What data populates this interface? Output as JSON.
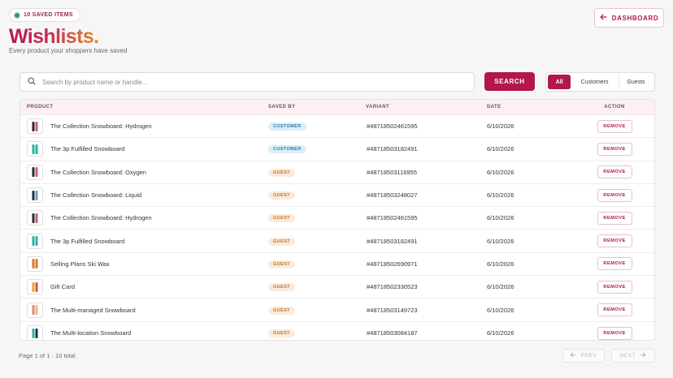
{
  "header": {
    "badge": "10 SAVED ITEMS",
    "title": "Wishlists.",
    "subtitle": "Every product your shoppers have saved",
    "dashboard_label": "DASHBOARD"
  },
  "search": {
    "placeholder": "Search by product name or handle...",
    "button_label": "SEARCH"
  },
  "filters": {
    "selected": "All",
    "options": [
      "All",
      "Customers",
      "Guests"
    ]
  },
  "table": {
    "columns": [
      "PRODUCT",
      "SAVED BY",
      "VARIANT",
      "DATE",
      "ACTION"
    ],
    "rows": [
      {
        "product": "The Collection Snowboard: Hydrogen",
        "saved_by": "CUSTOMER",
        "variant": "#48718502461595",
        "date": "6/10/2026",
        "action": "REMOVE",
        "thumb": [
          "#2b2b33",
          "#c65a8b"
        ]
      },
      {
        "product": "The 3p Fulfilled Snowboard",
        "saved_by": "CUSTOMER",
        "variant": "#48718503182491",
        "date": "6/10/2026",
        "action": "REMOVE",
        "thumb": [
          "#2bb3a3",
          "#2bb3a3"
        ]
      },
      {
        "product": "The Collection Snowboard: Oxygen",
        "saved_by": "GUEST",
        "variant": "#48718503116955",
        "date": "6/10/2026",
        "action": "REMOVE",
        "thumb": [
          "#2b2b33",
          "#d75a8f"
        ]
      },
      {
        "product": "The Collection Snowboard: Liquid",
        "saved_by": "GUEST",
        "variant": "#48718503248027",
        "date": "6/10/2026",
        "action": "REMOVE",
        "thumb": [
          "#2b2b33",
          "#6aa0c9"
        ]
      },
      {
        "product": "The Collection Snowboard: Hydrogen",
        "saved_by": "GUEST",
        "variant": "#48718502461595",
        "date": "6/10/2026",
        "action": "REMOVE",
        "thumb": [
          "#2b2b33",
          "#c65a8b"
        ]
      },
      {
        "product": "The 3p Fulfilled Snowboard",
        "saved_by": "GUEST",
        "variant": "#48718503182491",
        "date": "6/10/2026",
        "action": "REMOVE",
        "thumb": [
          "#2bb3a3",
          "#2bb3a3"
        ]
      },
      {
        "product": "Selling Plans Ski Wax",
        "saved_by": "GUEST",
        "variant": "#48718502690971",
        "date": "6/10/2026",
        "action": "REMOVE",
        "thumb": [
          "#e0782b",
          "#e0782b"
        ]
      },
      {
        "product": "Gift Card",
        "saved_by": "GUEST",
        "variant": "#48718502330523",
        "date": "6/10/2026",
        "action": "REMOVE",
        "thumb": [
          "#f0a23c",
          "#d9582c"
        ]
      },
      {
        "product": "The Multi-managed Snowboard",
        "saved_by": "GUEST",
        "variant": "#48718503149723",
        "date": "6/10/2026",
        "action": "REMOVE",
        "thumb": [
          "#e98a6a",
          "#f1b28f"
        ]
      },
      {
        "product": "The Multi-location Snowboard",
        "saved_by": "GUEST",
        "variant": "#48718503084187",
        "date": "6/10/2026",
        "action": "REMOVE",
        "thumb": [
          "#2bb3a3",
          "#2b2b33"
        ]
      }
    ]
  },
  "pagination": {
    "summary": "Page 1 of 1 · 10 total",
    "prev_label": "PREV",
    "next_label": "NEXT"
  },
  "colors": {
    "accent": "#b3164c",
    "customer_pill": "#d9eff9",
    "guest_pill": "#fbeadb"
  }
}
